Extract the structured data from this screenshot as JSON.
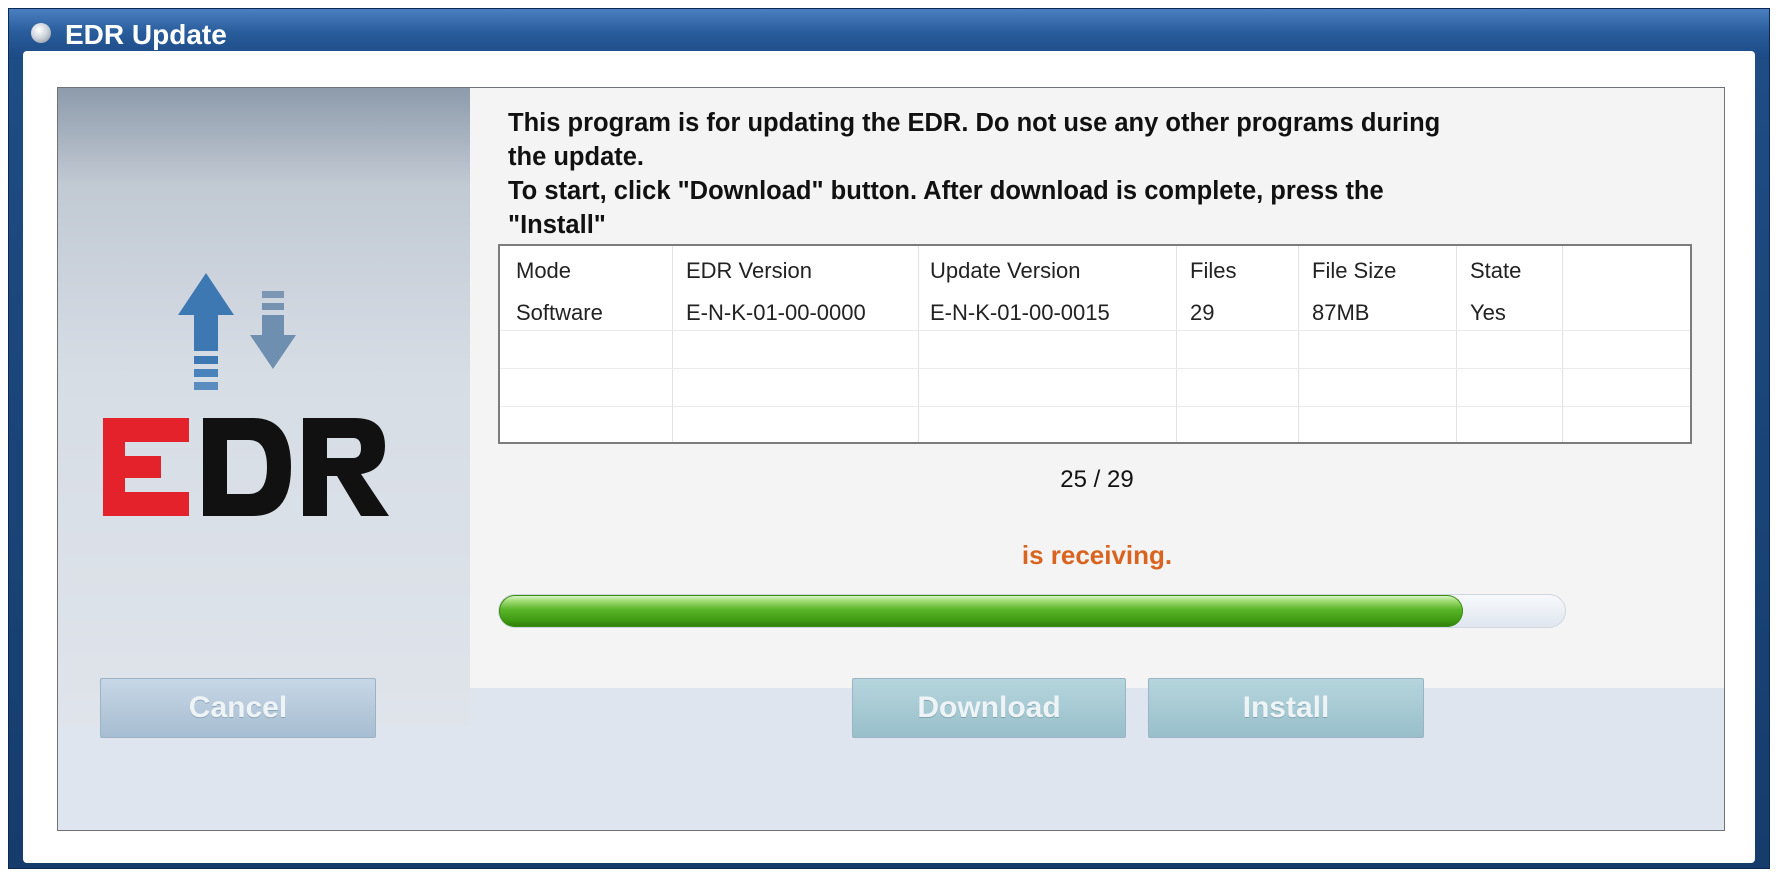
{
  "window": {
    "title": "EDR Update"
  },
  "logo": {
    "text": "EDR",
    "colors": {
      "red": "#e3222c",
      "black": "#111111",
      "arrow_up": "#3e78b2",
      "arrow_down": "#6e8fb0"
    }
  },
  "instructions": {
    "line1": "This program is for updating the EDR. Do not use any other programs during",
    "line2": "the update.",
    "line3": "To start, click \"Download\" button. After download is complete, press the",
    "line4": "\"Install\""
  },
  "table": {
    "columns": [
      "Mode",
      "EDR Version",
      "Update Version",
      "Files",
      "File Size",
      "State"
    ],
    "rows": [
      [
        "Software",
        "E-N-K-01-00-0000",
        "E-N-K-01-00-0015",
        "29",
        "87MB",
        "Yes"
      ]
    ]
  },
  "progress": {
    "counter": "25 / 29",
    "status": "is receiving.",
    "fraction": 0.904
  },
  "buttons": {
    "cancel": "Cancel",
    "download": "Download",
    "install": "Install"
  },
  "colors": {
    "status": "#d8641f",
    "progress_fill": "#4ca61d",
    "title_bar": "#2a5d9c"
  }
}
